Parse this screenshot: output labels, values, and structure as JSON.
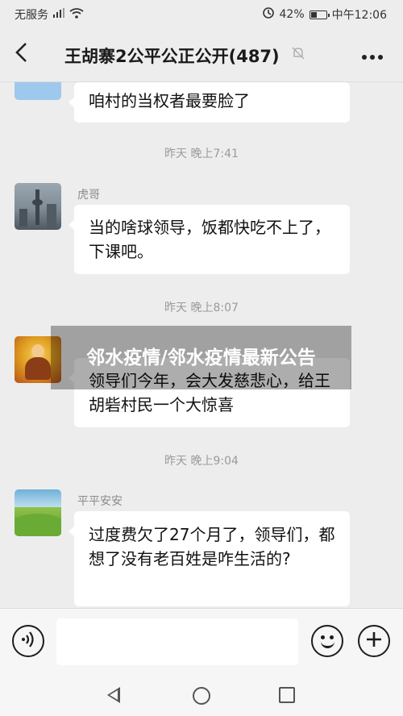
{
  "status_bar": {
    "carrier": "无服务",
    "signal_icon": "signal-icon",
    "wifi_icon": "wifi-icon",
    "alarm_icon": "alarm-icon",
    "battery": "42%",
    "battery_level": 0.42,
    "time": "中午12:06"
  },
  "header": {
    "back_icon": "chevron-left-icon",
    "title": "王胡寨2公平公正公开(487)",
    "mute_icon": "bell-muted-icon",
    "more_icon": "more-icon"
  },
  "messages": [
    {
      "type": "text",
      "sender": "",
      "text": "咱村的当权者最要脸了"
    },
    {
      "type": "time",
      "text": "昨天 晚上7:41"
    },
    {
      "type": "text",
      "sender": "虎哥",
      "text": "当的啥球领导，饭都快吃不上了，下课吧。"
    },
    {
      "type": "time",
      "text": "昨天 晚上8:07"
    },
    {
      "type": "text",
      "sender": "",
      "text": "领导们今年，会大发慈悲心，给王胡砦村民一个大惊喜"
    },
    {
      "type": "time",
      "text": "昨天 晚上9:04"
    },
    {
      "type": "text",
      "sender": "平平安安",
      "text": "过度费欠了27个月了，领导们，都想了没有老百姓是咋生活的?"
    }
  ],
  "overlay": {
    "text": "邻水疫情/邻水疫情最新公告"
  },
  "input_bar": {
    "voice_icon": "voice-icon",
    "input_value": "",
    "emoji_icon": "emoji-icon",
    "plus_icon": "plus-icon"
  },
  "system_nav": {
    "back_icon": "triangle-back-icon",
    "home_icon": "circle-home-icon",
    "recent_icon": "square-recent-icon"
  }
}
